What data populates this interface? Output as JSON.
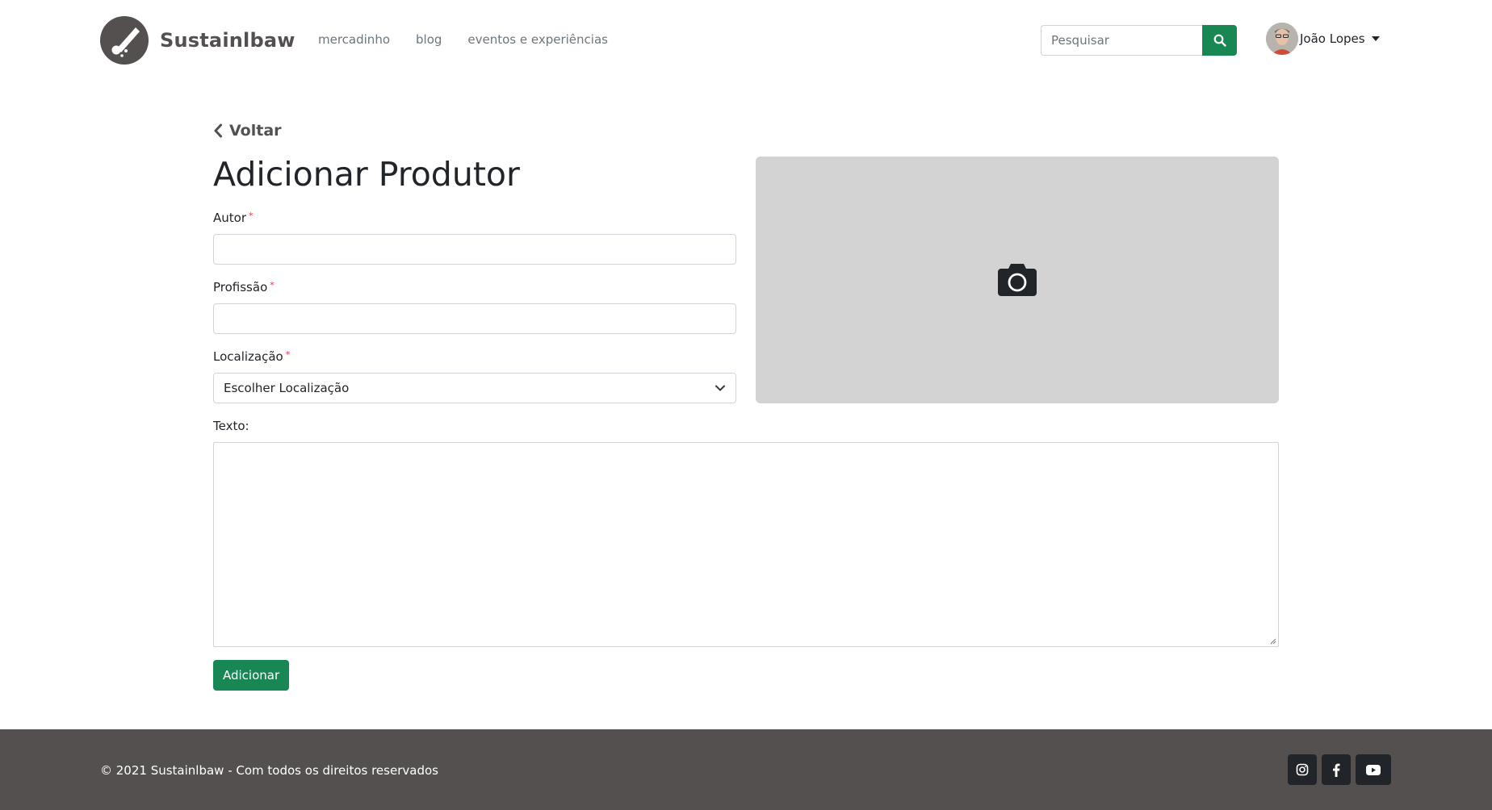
{
  "header": {
    "brand_name": "Sustainlbaw",
    "nav": [
      {
        "label": "mercadinho"
      },
      {
        "label": "blog"
      },
      {
        "label": "eventos e experiências"
      }
    ],
    "search": {
      "placeholder": "Pesquisar",
      "value": ""
    },
    "user": {
      "name": "João Lopes"
    }
  },
  "page": {
    "back_label": "Voltar",
    "title": "Adicionar Produtor",
    "form": {
      "author": {
        "label": "Autor",
        "required_mark": "*",
        "value": ""
      },
      "profession": {
        "label": "Profissão",
        "required_mark": "*",
        "value": ""
      },
      "location": {
        "label": "Localização",
        "required_mark": "*",
        "selected": "Escolher Localização"
      },
      "text": {
        "label": "Texto:",
        "value": ""
      },
      "submit_label": "Adicionar"
    },
    "image_upload": {
      "icon": "camera-icon"
    }
  },
  "footer": {
    "copyright": "© 2021 Sustainlbaw - Com todos os direitos reservados",
    "social": [
      {
        "icon": "instagram-icon"
      },
      {
        "icon": "facebook-icon"
      },
      {
        "icon": "youtube-icon"
      }
    ]
  },
  "colors": {
    "brand": "#545050",
    "primary_button": "#198754",
    "image_placeholder": "#d3d3d3",
    "required": "#dc3545",
    "footer_bg": "#545050",
    "social_button": "#212529"
  }
}
